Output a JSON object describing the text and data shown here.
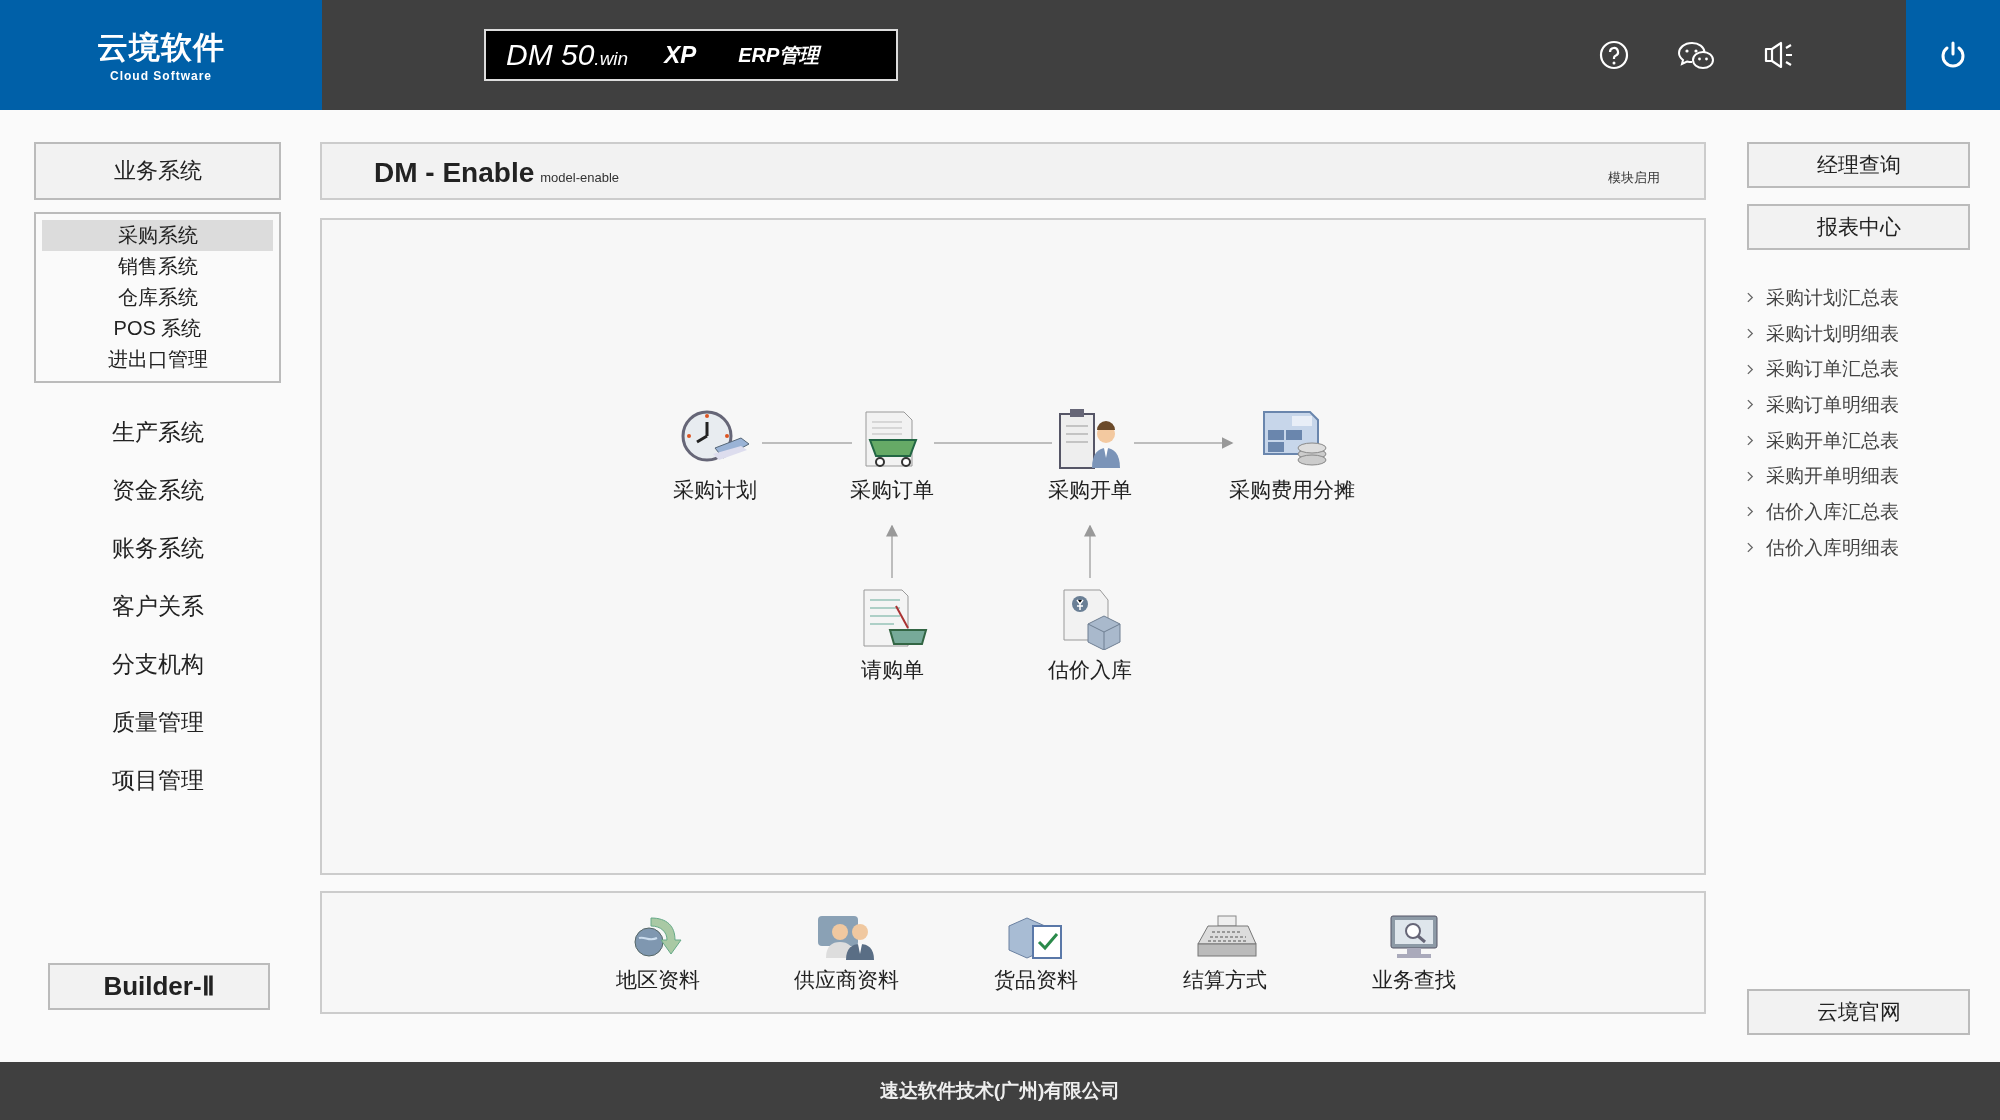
{
  "header": {
    "logo_title": "云境软件",
    "logo_subtitle": "Cloud Software",
    "product": {
      "name": "DM 50",
      "suffix": ".win",
      "edition": "XP",
      "module": "ERP管理"
    }
  },
  "left_nav": {
    "section_button": "业务系统",
    "submenu": [
      {
        "label": "采购系统",
        "selected": true
      },
      {
        "label": "销售系统",
        "selected": false
      },
      {
        "label": "仓库系统",
        "selected": false
      },
      {
        "label": "POS 系统",
        "selected": false
      },
      {
        "label": "进出口管理",
        "selected": false
      }
    ],
    "items": [
      "生产系统",
      "资金系统",
      "账务系统",
      "客户关系",
      "分支机构",
      "质量管理",
      "项目管理"
    ],
    "builder_button": "Builder-Ⅱ"
  },
  "main": {
    "title": "DM - Enable",
    "subtitle": "model-enable",
    "tag": "模块启用",
    "flow_nodes": [
      "采购计划",
      "采购订单",
      "采购开单",
      "采购费用分摊",
      "请购单",
      "估价入库"
    ],
    "shortcuts": [
      "地区资料",
      "供应商资料",
      "货品资料",
      "结算方式",
      "业务查找"
    ]
  },
  "right_panel": {
    "buttons": [
      "经理查询",
      "报表中心"
    ],
    "report_links": [
      "采购计划汇总表",
      "采购计划明细表",
      "采购订单汇总表",
      "采购订单明细表",
      "采购开单汇总表",
      "采购开单明细表",
      "估价入库汇总表",
      "估价入库明细表"
    ],
    "website_button": "云境官网"
  },
  "footer": "速达软件技术(广州)有限公司"
}
